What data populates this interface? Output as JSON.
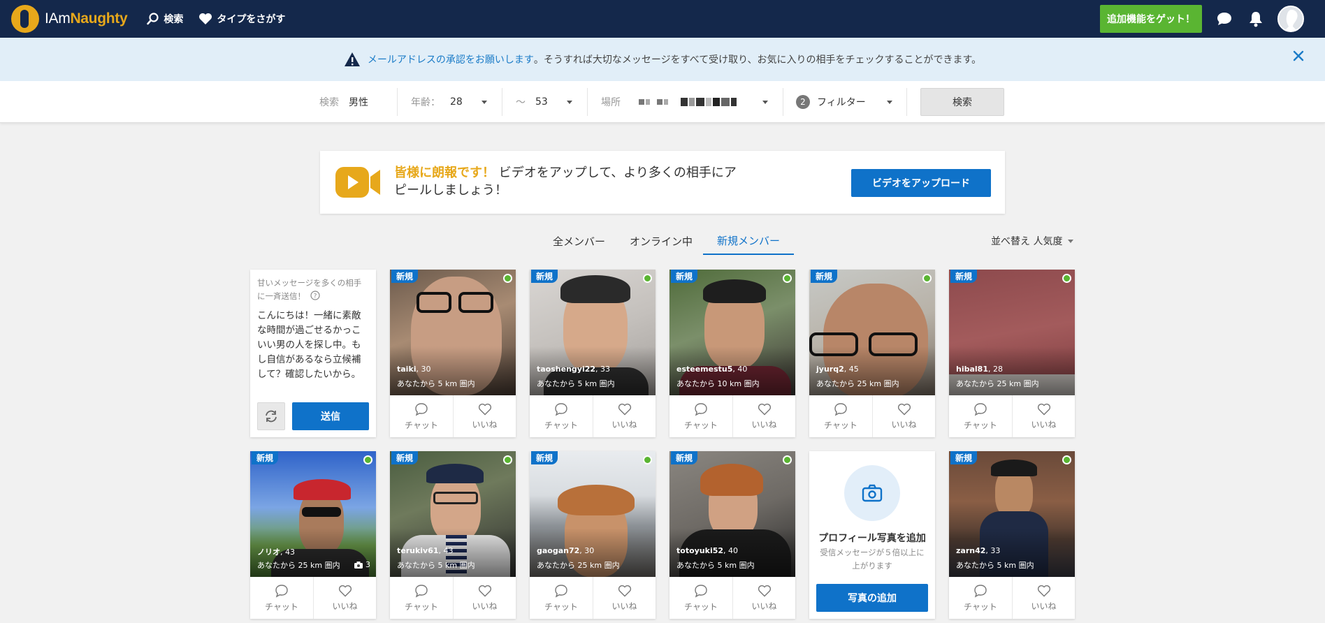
{
  "brand": {
    "name_plain": "IAm",
    "name_bold": "Naughty"
  },
  "nav": {
    "search": "検索",
    "find_type": "タイプをさがす"
  },
  "header": {
    "upgrade_button": "追加機能をゲット！"
  },
  "notice": {
    "link_text": "メールアドレスの承認をお願いします",
    "rest_text": "。そうすれば大切なメッセージをすべて受け取り、お気に入りの相手をチェックすることができます。"
  },
  "filters": {
    "search_label": "検索",
    "gender": "男性",
    "age_label": "年齢：",
    "age_min": "28",
    "age_sep": "～",
    "age_max": "53",
    "location_label": "場所",
    "filter_count": "2",
    "filter_label": "フィルター",
    "search_button": "検索"
  },
  "promo": {
    "highlight": "皆様に朗報です！",
    "text": "ビデオをアップして、より多くの相手にアピールしましょう！",
    "button": "ビデオをアップロード"
  },
  "tabs": [
    "全メンバー",
    "オンライン中",
    "新規メンバー"
  ],
  "active_tab": "新規メンバー",
  "sort": {
    "label": "並べ替え",
    "value": "人気度"
  },
  "message_card": {
    "header": "甘いメッセージを多くの相手に一斉送信！",
    "body": "こんにちは！一緒に素敵な時間が過ごせるかっこいい男の人を探し中。もし自信があるなら立候補して？確認したいから。",
    "send_button": "送信"
  },
  "profile_labels": {
    "new_badge": "新規",
    "chat": "チャット",
    "like": "いいね"
  },
  "profiles": [
    {
      "name": "taiki",
      "age": ", 30",
      "distance": "あなたから 5 km 圏内"
    },
    {
      "name": "taoshengyi22",
      "age": ", 33",
      "distance": "あなたから 5 km 圏内"
    },
    {
      "name": "esteemestu5",
      "age": ", 40",
      "distance": "あなたから 10 km 圏内"
    },
    {
      "name": "jyurq2",
      "age": ", 45",
      "distance": "あなたから 25 km 圏内"
    },
    {
      "name": "hibal81",
      "age": ", 28",
      "distance": "あなたから 25 km 圏内"
    },
    {
      "name": "ノリオ",
      "age": ", 43",
      "distance": "あなたから 25 km 圏内",
      "photo_count": "3"
    },
    {
      "name": "terukiv61",
      "age": ", 43",
      "distance": "あなたから 5 km 圏内"
    },
    {
      "name": "gaogan72",
      "age": ", 30",
      "distance": "あなたから 25 km 圏内"
    },
    {
      "name": "totoyuki52",
      "age": ", 40",
      "distance": "あなたから 5 km 圏内"
    },
    {
      "name": "zarn42",
      "age": ", 33",
      "distance": "あなたから 5 km 圏内"
    }
  ],
  "add_photo_card": {
    "title": "プロフィール写真を追加",
    "subtitle": "受信メッセージが５倍以上に上がります",
    "button": "写真の追加"
  },
  "colors": {
    "header": "#14284b",
    "brand": "#e7a81b",
    "accent": "#0f72c9",
    "online": "#5ab532"
  }
}
